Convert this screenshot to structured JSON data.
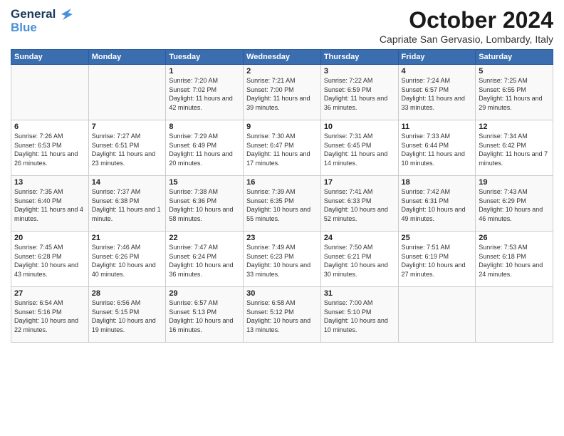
{
  "logo": {
    "line1": "General",
    "line2": "Blue"
  },
  "title": "October 2024",
  "subtitle": "Capriate San Gervasio, Lombardy, Italy",
  "headers": [
    "Sunday",
    "Monday",
    "Tuesday",
    "Wednesday",
    "Thursday",
    "Friday",
    "Saturday"
  ],
  "weeks": [
    [
      {
        "day": "",
        "info": ""
      },
      {
        "day": "",
        "info": ""
      },
      {
        "day": "1",
        "info": "Sunrise: 7:20 AM\nSunset: 7:02 PM\nDaylight: 11 hours and 42 minutes."
      },
      {
        "day": "2",
        "info": "Sunrise: 7:21 AM\nSunset: 7:00 PM\nDaylight: 11 hours and 39 minutes."
      },
      {
        "day": "3",
        "info": "Sunrise: 7:22 AM\nSunset: 6:59 PM\nDaylight: 11 hours and 36 minutes."
      },
      {
        "day": "4",
        "info": "Sunrise: 7:24 AM\nSunset: 6:57 PM\nDaylight: 11 hours and 33 minutes."
      },
      {
        "day": "5",
        "info": "Sunrise: 7:25 AM\nSunset: 6:55 PM\nDaylight: 11 hours and 29 minutes."
      }
    ],
    [
      {
        "day": "6",
        "info": "Sunrise: 7:26 AM\nSunset: 6:53 PM\nDaylight: 11 hours and 26 minutes."
      },
      {
        "day": "7",
        "info": "Sunrise: 7:27 AM\nSunset: 6:51 PM\nDaylight: 11 hours and 23 minutes."
      },
      {
        "day": "8",
        "info": "Sunrise: 7:29 AM\nSunset: 6:49 PM\nDaylight: 11 hours and 20 minutes."
      },
      {
        "day": "9",
        "info": "Sunrise: 7:30 AM\nSunset: 6:47 PM\nDaylight: 11 hours and 17 minutes."
      },
      {
        "day": "10",
        "info": "Sunrise: 7:31 AM\nSunset: 6:45 PM\nDaylight: 11 hours and 14 minutes."
      },
      {
        "day": "11",
        "info": "Sunrise: 7:33 AM\nSunset: 6:44 PM\nDaylight: 11 hours and 10 minutes."
      },
      {
        "day": "12",
        "info": "Sunrise: 7:34 AM\nSunset: 6:42 PM\nDaylight: 11 hours and 7 minutes."
      }
    ],
    [
      {
        "day": "13",
        "info": "Sunrise: 7:35 AM\nSunset: 6:40 PM\nDaylight: 11 hours and 4 minutes."
      },
      {
        "day": "14",
        "info": "Sunrise: 7:37 AM\nSunset: 6:38 PM\nDaylight: 11 hours and 1 minute."
      },
      {
        "day": "15",
        "info": "Sunrise: 7:38 AM\nSunset: 6:36 PM\nDaylight: 10 hours and 58 minutes."
      },
      {
        "day": "16",
        "info": "Sunrise: 7:39 AM\nSunset: 6:35 PM\nDaylight: 10 hours and 55 minutes."
      },
      {
        "day": "17",
        "info": "Sunrise: 7:41 AM\nSunset: 6:33 PM\nDaylight: 10 hours and 52 minutes."
      },
      {
        "day": "18",
        "info": "Sunrise: 7:42 AM\nSunset: 6:31 PM\nDaylight: 10 hours and 49 minutes."
      },
      {
        "day": "19",
        "info": "Sunrise: 7:43 AM\nSunset: 6:29 PM\nDaylight: 10 hours and 46 minutes."
      }
    ],
    [
      {
        "day": "20",
        "info": "Sunrise: 7:45 AM\nSunset: 6:28 PM\nDaylight: 10 hours and 43 minutes."
      },
      {
        "day": "21",
        "info": "Sunrise: 7:46 AM\nSunset: 6:26 PM\nDaylight: 10 hours and 40 minutes."
      },
      {
        "day": "22",
        "info": "Sunrise: 7:47 AM\nSunset: 6:24 PM\nDaylight: 10 hours and 36 minutes."
      },
      {
        "day": "23",
        "info": "Sunrise: 7:49 AM\nSunset: 6:23 PM\nDaylight: 10 hours and 33 minutes."
      },
      {
        "day": "24",
        "info": "Sunrise: 7:50 AM\nSunset: 6:21 PM\nDaylight: 10 hours and 30 minutes."
      },
      {
        "day": "25",
        "info": "Sunrise: 7:51 AM\nSunset: 6:19 PM\nDaylight: 10 hours and 27 minutes."
      },
      {
        "day": "26",
        "info": "Sunrise: 7:53 AM\nSunset: 6:18 PM\nDaylight: 10 hours and 24 minutes."
      }
    ],
    [
      {
        "day": "27",
        "info": "Sunrise: 6:54 AM\nSunset: 5:16 PM\nDaylight: 10 hours and 22 minutes."
      },
      {
        "day": "28",
        "info": "Sunrise: 6:56 AM\nSunset: 5:15 PM\nDaylight: 10 hours and 19 minutes."
      },
      {
        "day": "29",
        "info": "Sunrise: 6:57 AM\nSunset: 5:13 PM\nDaylight: 10 hours and 16 minutes."
      },
      {
        "day": "30",
        "info": "Sunrise: 6:58 AM\nSunset: 5:12 PM\nDaylight: 10 hours and 13 minutes."
      },
      {
        "day": "31",
        "info": "Sunrise: 7:00 AM\nSunset: 5:10 PM\nDaylight: 10 hours and 10 minutes."
      },
      {
        "day": "",
        "info": ""
      },
      {
        "day": "",
        "info": ""
      }
    ]
  ]
}
